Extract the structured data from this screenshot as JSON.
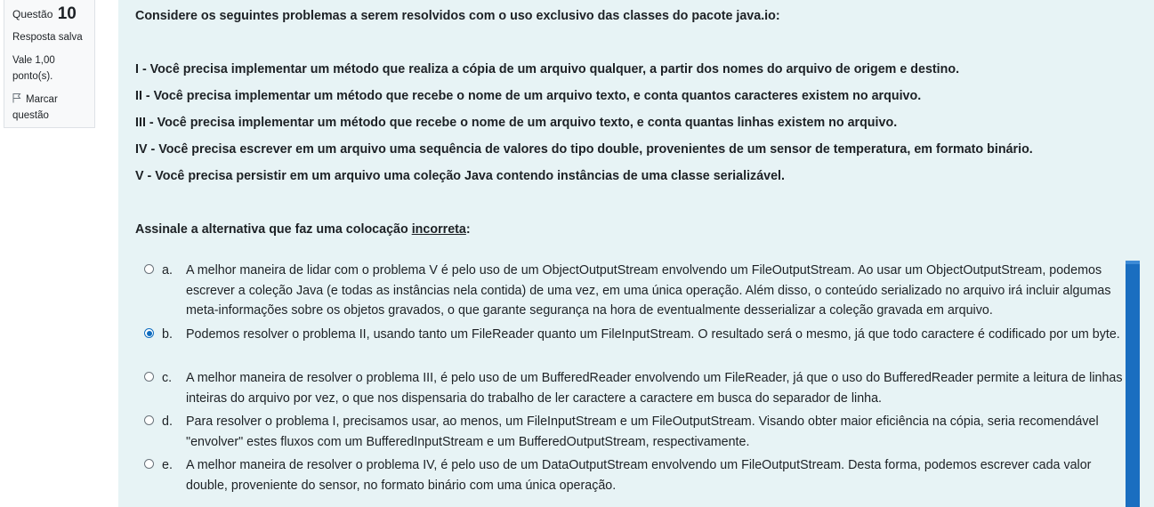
{
  "question_info": {
    "prefix": "Questão",
    "number": "10",
    "status": "Resposta salva",
    "grade_line1": "Vale 1,00",
    "grade_line2": "ponto(s).",
    "flag_line1": "Marcar",
    "flag_line2": "questão"
  },
  "question": {
    "intro": "Considere os seguintes problemas a serem resolvidos com o uso exclusivo das classes do pacote java.io:",
    "problems": [
      "I - Você precisa implementar um método que realiza a cópia de um arquivo qualquer, a partir dos nomes do arquivo de origem e destino.",
      "II - Você precisa implementar um método que recebe o nome de um arquivo texto, e conta quantos caracteres existem no arquivo.",
      "III - Você precisa implementar um método que recebe o nome de um arquivo texto, e conta quantas linhas existem no arquivo.",
      "IV - Você precisa escrever em um arquivo uma sequência de valores do tipo double, provenientes de um sensor de temperatura, em formato binário.",
      "V - Você precisa persistir em um arquivo uma coleção Java contendo instâncias de uma classe serializável."
    ],
    "prompt_before": "Assinale a alternativa que faz uma colocação ",
    "prompt_underlined": "incorreta",
    "prompt_after": ":"
  },
  "options": [
    {
      "letter": "a.",
      "selected": false,
      "text": "A melhor maneira de lidar com o problema V é pelo uso de um ObjectOutputStream envolvendo um FileOutputStream. Ao usar um ObjectOutputStream, podemos escrever a coleção Java (e todas as instâncias nela contida) de uma vez, em uma única operação. Além disso, o conteúdo serializado no arquivo irá incluir algumas meta-informações sobre os objetos gravados, o que garante segurança na hora de eventualmente desserializar a coleção gravada em arquivo."
    },
    {
      "letter": "b.",
      "selected": true,
      "text": "Podemos resolver o problema II, usando tanto um FileReader quanto um FileInputStream. O resultado será o mesmo, já que todo caractere é codificado por um byte."
    },
    {
      "letter": "c.",
      "selected": false,
      "text": "A melhor maneira de resolver o problema III, é pelo uso de um BufferedReader envolvendo um FileReader, já que o uso do BufferedReader permite a leitura de linhas inteiras do arquivo por vez, o que nos dispensaria do trabalho de ler caractere a caractere em busca do separador de linha."
    },
    {
      "letter": "d.",
      "selected": false,
      "text": "Para resolver o problema I, precisamos usar, ao menos, um FileInputStream e um FileOutputStream. Visando obter maior eficiência na cópia, seria recomendável \"envolver\" estes fluxos com um BufferedInputStream e um BufferedOutputStream, respectivamente."
    },
    {
      "letter": "e.",
      "selected": false,
      "text": "A melhor maneira de resolver o problema IV, é pelo uso de um DataOutputStream envolvendo um FileOutputStream. Desta forma, podemos escrever cada valor double, proveniente do sensor, no formato binário com uma única operação."
    }
  ],
  "colors": {
    "content_bg": "#e7f3f5",
    "accent": "#0f6cbf",
    "scrollbar": "#1a6ec0"
  }
}
